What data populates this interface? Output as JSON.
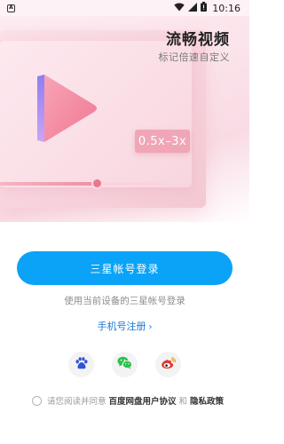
{
  "status_bar": {
    "time": "10:16",
    "icons": [
      "notification-icon",
      "wifi-icon",
      "signal-icon",
      "battery-icon"
    ]
  },
  "feature": {
    "title": "流畅视频",
    "subtitle": "标记倍速自定义",
    "speed_label": "0.5x–3x",
    "progress": 0.58
  },
  "login": {
    "primary_button": "三星帐号登录",
    "hint": "使用当前设备的三星帐号登录",
    "phone_register": "手机号注册",
    "phone_register_chevron": "›"
  },
  "social": [
    {
      "name": "baidu-icon",
      "color": "#2f54d9"
    },
    {
      "name": "wechat-icon",
      "color": "#2bc04a"
    },
    {
      "name": "weibo-icon",
      "color": "#e6352f"
    }
  ],
  "agreement": {
    "prefix": "请您阅读并同意",
    "user_agreement": "百度网盘用户协议",
    "and": "和",
    "privacy_policy": "隐私政策"
  },
  "colors": {
    "accent": "#0aa3f7",
    "link": "#1677d8",
    "hero_pink": "#f0a6b6"
  }
}
